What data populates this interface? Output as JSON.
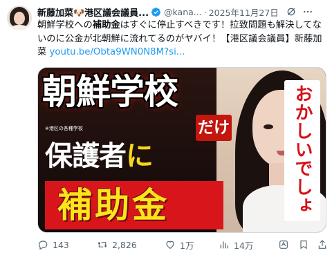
{
  "author": {
    "name": "新藤加菜🐶港区議会議員...",
    "handle": "@kana...",
    "separator": "·",
    "date": "2025年11月27日"
  },
  "body": {
    "line1_prefix": "朝鮮学校への",
    "line1_bold": "補助金",
    "line1_suffix": "はすぐに停止すべきです！拉致問題も解決してないのに公金が北朝鮮に流れてるのがヤバイ！【港区議会議員】新藤加菜 ",
    "link": "youtu.be/Obta9WN0N8M?si..."
  },
  "thumbnail": {
    "headline": "朝鮮学校",
    "tag": "だけ",
    "note": "※港区の各種学校",
    "line2_main": "保護者",
    "line2_particle": "に",
    "line3": "補助金",
    "callout": "おかしいでしょ"
  },
  "actions": {
    "replies": "143",
    "reposts": "2,826",
    "likes": "1万",
    "views": "14万"
  },
  "colors": {
    "link": "#1d9bf0",
    "verified": "#1d9bf0",
    "muted": "#536471",
    "thumb_red": "#d9151c",
    "thumb_yellow": "#fbe41c"
  },
  "icons": [
    "verified-badge-icon",
    "grok-icon",
    "more-icon",
    "reply-icon",
    "repost-icon",
    "like-icon",
    "views-icon",
    "grok-action-icon",
    "bookmark-icon",
    "share-icon"
  ]
}
